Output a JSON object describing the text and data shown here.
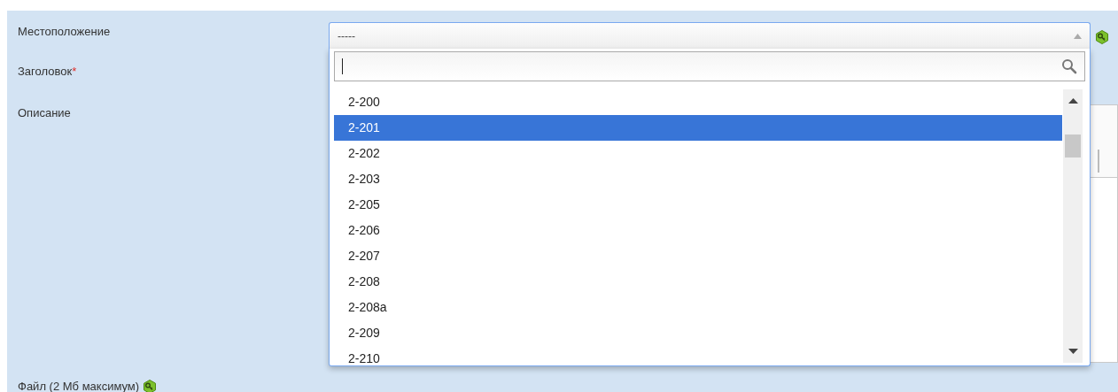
{
  "location": {
    "label": "Местоположение",
    "value": "-----",
    "expanded": true,
    "options": [
      {
        "label": "2-200",
        "selected": false
      },
      {
        "label": "2-201",
        "selected": true
      },
      {
        "label": "2-202",
        "selected": false
      },
      {
        "label": "2-203",
        "selected": false
      },
      {
        "label": "2-205",
        "selected": false
      },
      {
        "label": "2-206",
        "selected": false
      },
      {
        "label": "2-207",
        "selected": false
      },
      {
        "label": "2-208",
        "selected": false
      },
      {
        "label": "2-208a",
        "selected": false
      },
      {
        "label": "2-209",
        "selected": false
      },
      {
        "label": "2-210",
        "selected": false
      }
    ]
  },
  "title_field": {
    "label": "Заголовок",
    "required_mark": "*"
  },
  "description": {
    "label": "Описание"
  },
  "file": {
    "label": "Файл (2 Мб максимум)"
  }
}
